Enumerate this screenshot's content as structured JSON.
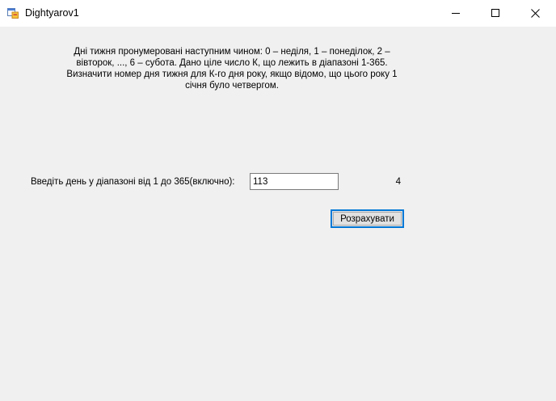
{
  "window": {
    "title": "Dightyarov1",
    "app_icon": "winforms-app-icon",
    "controls": {
      "minimize_icon": "minimize-icon",
      "maximize_icon": "maximize-icon",
      "close_icon": "close-icon"
    }
  },
  "form": {
    "description_lines": [
      "Дні тижня пронумеровані наступним чином: 0 – неділя, 1 – понеділок, 2 –",
      "вівторок, ..., 6 – субота. Дано ціле число К, що лежить в діапазоні 1-365.",
      "Визначити номер дня тижня для К-го дня року, якщо відомо, що цього року 1",
      "січня було четвергом."
    ],
    "day_label": "Введіть день у діапазоні від 1 до 365(включно):",
    "day_value": "113",
    "result": "4",
    "calculate_label": "Розрахувати"
  },
  "colors": {
    "form_background": "#f0f0f0",
    "titlebar_background": "#ffffff",
    "button_focus_border": "#0078d7",
    "button_background": "#e1e1e1"
  }
}
